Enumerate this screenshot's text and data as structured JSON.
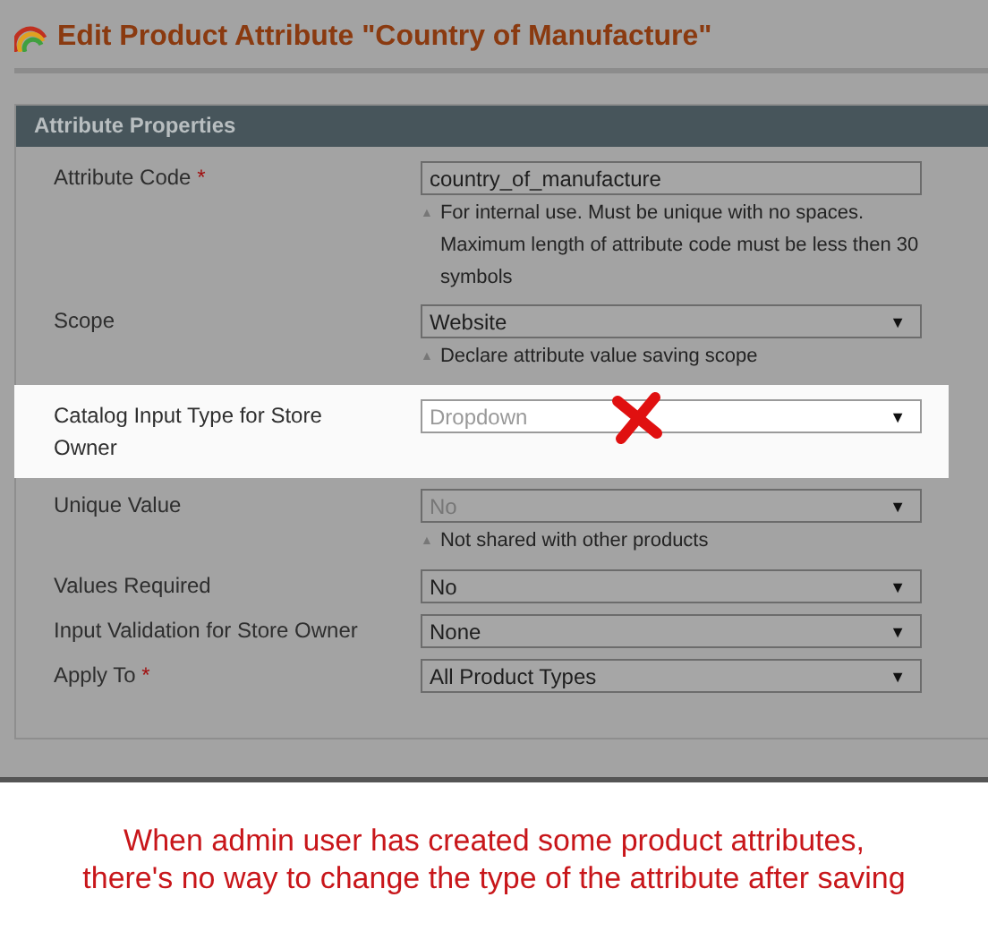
{
  "page_title": "Edit Product Attribute \"Country of Manufacture\"",
  "section": {
    "title": "Attribute Properties"
  },
  "fields": [
    {
      "label": "Attribute Code",
      "required": true,
      "kind": "text",
      "value": "country_of_manufacture",
      "disabled": false,
      "highlighted": false,
      "note": "For internal use. Must be unique with no spaces. Maximum length of attribute code must be less then 30 symbols"
    },
    {
      "label": "Scope",
      "required": false,
      "kind": "select",
      "value": "Website",
      "disabled": false,
      "highlighted": false,
      "note": "Declare attribute value saving scope"
    },
    {
      "label": "Catalog Input Type for Store Owner",
      "required": false,
      "kind": "select",
      "value": "Dropdown",
      "disabled": true,
      "highlighted": true,
      "crossed": true
    },
    {
      "label": "Unique Value",
      "required": false,
      "kind": "select",
      "value": "No",
      "disabled": true,
      "highlighted": false,
      "note": "Not shared with other products"
    },
    {
      "label": "Values Required",
      "required": false,
      "kind": "select",
      "value": "No",
      "disabled": false,
      "highlighted": false
    },
    {
      "label": "Input Validation for Store Owner",
      "required": false,
      "kind": "select",
      "value": "None",
      "disabled": false,
      "highlighted": false
    },
    {
      "label": "Apply To",
      "required": true,
      "kind": "select",
      "value": "All Product Types",
      "disabled": false,
      "highlighted": false
    }
  ],
  "required_mark": "*",
  "select_arrow": "▼",
  "note_mark": "▲",
  "caption": "When admin user has created some product attributes,\nthere's no way to change the type of the attribute after saving"
}
